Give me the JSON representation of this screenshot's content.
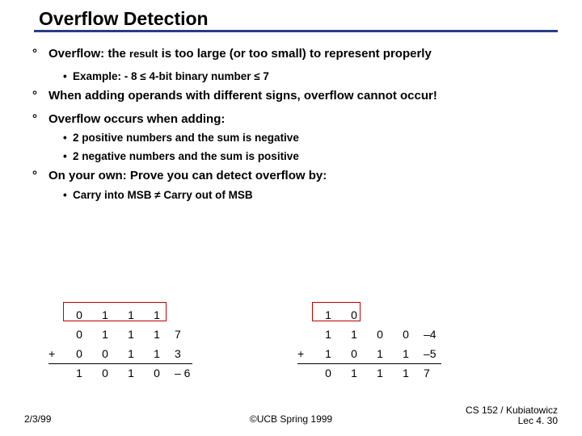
{
  "title": "Overflow Detection",
  "p1a": "Overflow: the ",
  "p1b": "result",
  "p1c": " is too large (or too small) to represent properly",
  "p1_ex": "Example: - 8 ≤ 4-bit binary number ≤ 7",
  "p2": "When adding operands with different signs, overflow cannot occur!",
  "p3": "Overflow occurs when adding:",
  "p3_a": "2 positive numbers and the sum is negative",
  "p3_b": "2 negative numbers and the sum is positive",
  "p4": "On your own: Prove you can detect overflow by:",
  "p4_a": "Carry into MSB ≠ Carry out of MSB",
  "ex1": {
    "carry": [
      "0",
      "1",
      "1",
      "1"
    ],
    "a": [
      "0",
      "1",
      "1",
      "1"
    ],
    "aval": "7",
    "b": [
      "0",
      "0",
      "1",
      "1"
    ],
    "bval": "3",
    "s": [
      "1",
      "0",
      "1",
      "0"
    ],
    "sval": "– 6",
    "op": "+"
  },
  "ex2": {
    "carry": [
      "1",
      "0"
    ],
    "a": [
      "1",
      "1",
      "0",
      "0"
    ],
    "aval": "–4",
    "b": [
      "1",
      "0",
      "1",
      "1"
    ],
    "bval": "–5",
    "s": [
      "0",
      "1",
      "1",
      "1"
    ],
    "sval": "7",
    "op": "+"
  },
  "footer": {
    "date": "2/3/99",
    "center": "©UCB Spring 1999",
    "right1": "CS 152 / Kubiatowicz",
    "right2": "Lec 4. 30"
  }
}
